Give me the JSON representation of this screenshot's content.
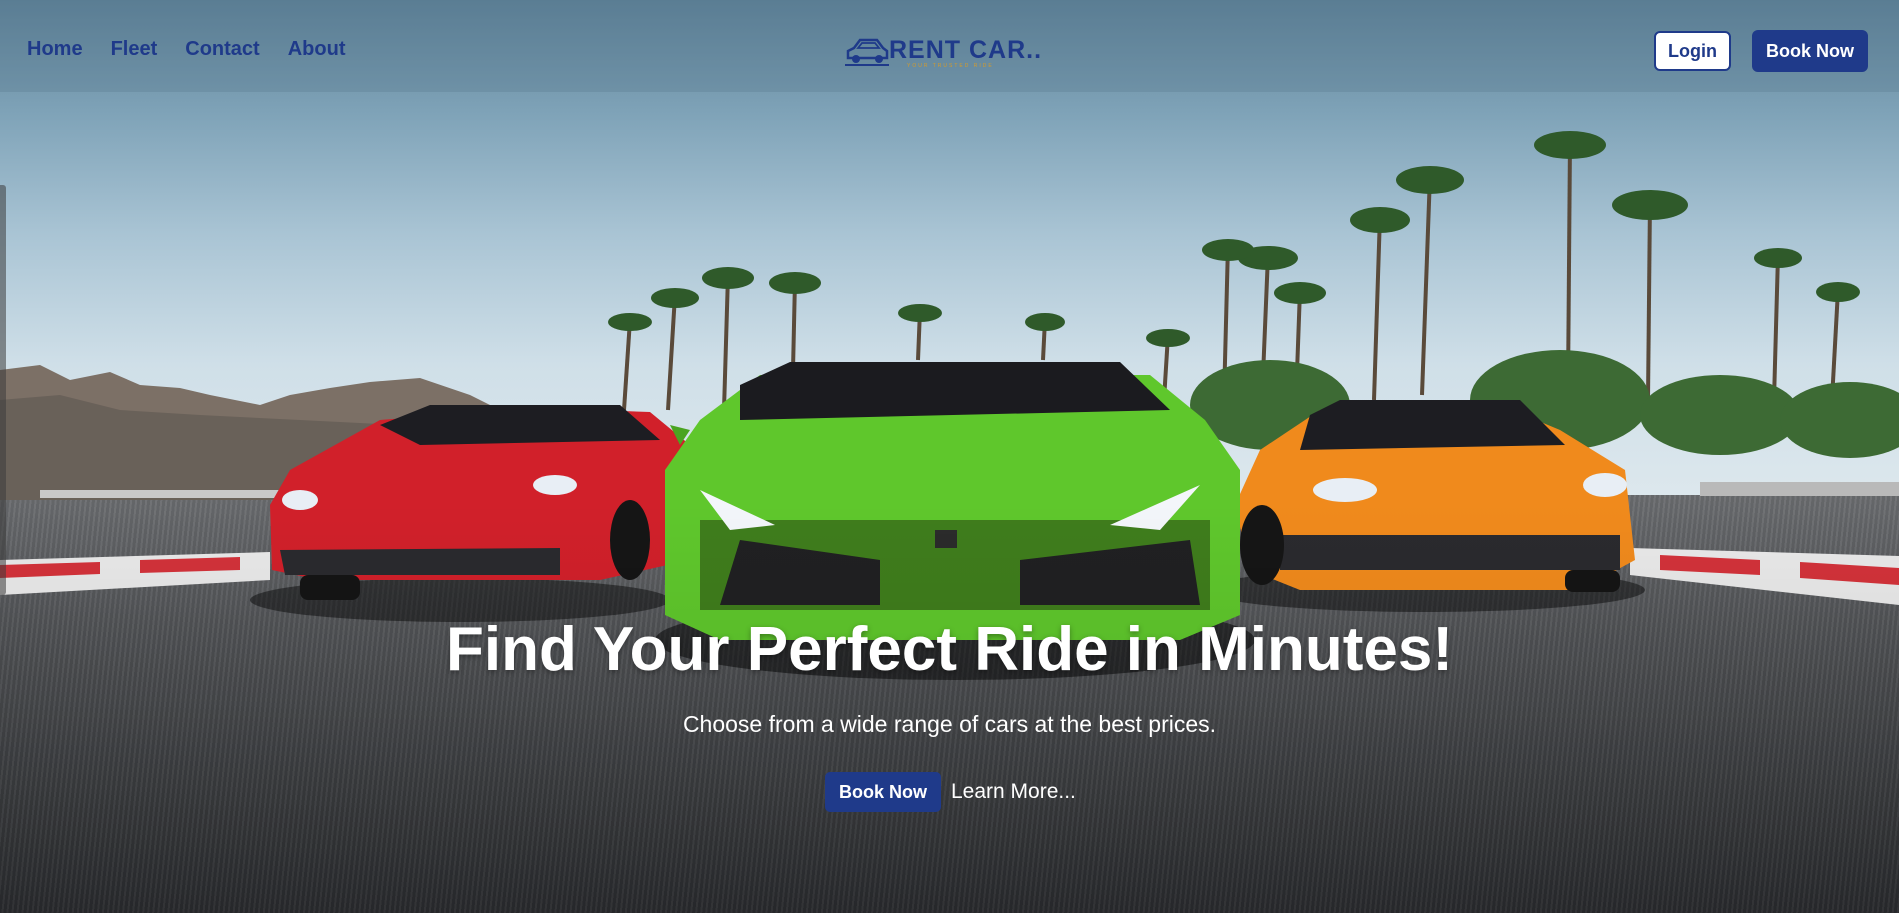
{
  "nav": {
    "links": [
      {
        "label": "Home"
      },
      {
        "label": "Fleet"
      },
      {
        "label": "Contact"
      },
      {
        "label": "About"
      }
    ],
    "login_label": "Login",
    "book_label": "Book Now"
  },
  "logo": {
    "text": "RENT CAR..",
    "tagline": "YOUR TRUSTED RIDE"
  },
  "hero": {
    "title": "Find Your Perfect Ride in Minutes!",
    "subtitle": "Choose from a wide range of cars at the best prices.",
    "book_label": "Book Now",
    "learn_more_label": "Learn More..."
  },
  "colors": {
    "brand_blue": "#1f3a8a",
    "accent_gold": "#d49b2b",
    "car_red": "#d1202a",
    "car_green": "#5fc72c",
    "car_orange": "#f08a1c"
  }
}
